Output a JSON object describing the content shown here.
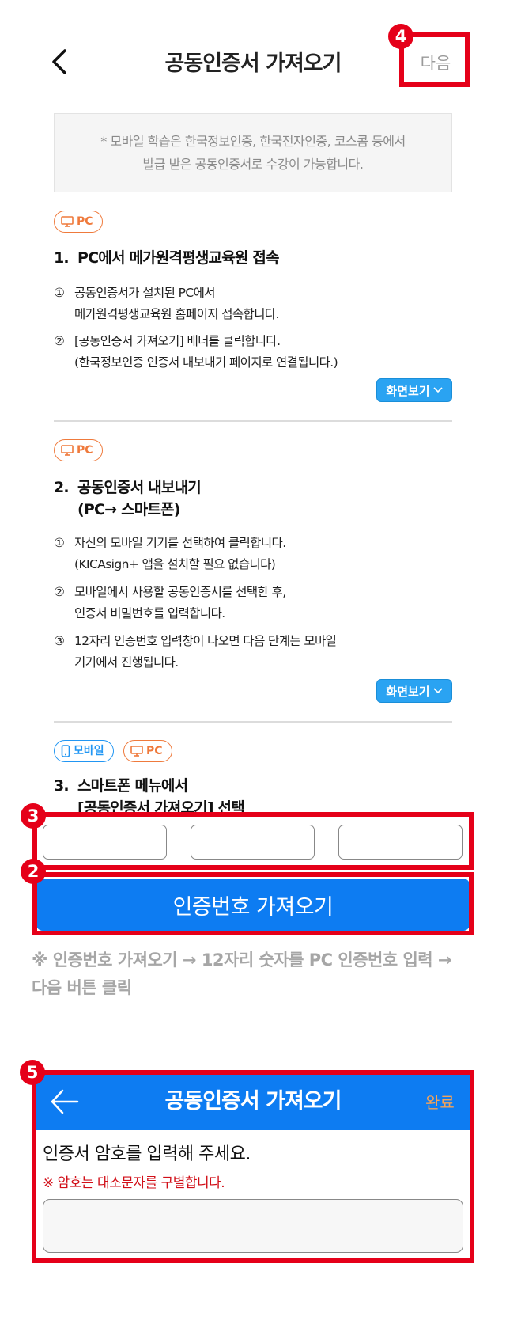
{
  "header": {
    "title": "공동인증서 가져오기",
    "next_label": "다음"
  },
  "notice": {
    "line1": "* 모바일 학습은 한국정보인증, 한국전자인증, 코스콤 등에서",
    "line2": "발급 받은 공동인증서로 수강이 가능합니다."
  },
  "tags": {
    "pc": "PC",
    "mobile": "모바일"
  },
  "steps": [
    {
      "num": "1.",
      "title": [
        "PC에서 메가원격평생교육원 접속"
      ],
      "items": [
        {
          "mark": "①",
          "lines": [
            "공동인증서가 설치된 PC에서",
            "메가원격평생교육원 홈페이지 접속합니다."
          ]
        },
        {
          "mark": "②",
          "lines": [
            "[공동인증서 가져오기] 배너를 클릭합니다.",
            "(한국정보인증 인증서 내보내기 페이지로 연결됩니다.)"
          ]
        }
      ],
      "view_label": "화면보기"
    },
    {
      "num": "2.",
      "title": [
        "공동인증서 내보내기",
        "(PC→ 스마트폰)"
      ],
      "items": [
        {
          "mark": "①",
          "lines": [
            "자신의 모바일 기기를 선택하여 클릭합니다.",
            "(KICAsign+ 앱을 설치할 필요 없습니다)"
          ]
        },
        {
          "mark": "②",
          "lines": [
            "모바일에서 사용할 공동인증서를 선택한 후,",
            "인증서 비밀번호를 입력합니다."
          ]
        },
        {
          "mark": "③",
          "lines": [
            "12자리 인증번호 입력창이 나오면 다음 단계는 모바일",
            "기기에서 진행됩니다."
          ]
        }
      ],
      "view_label": "화면보기"
    },
    {
      "num": "3.",
      "title": [
        "스마트폰 메뉴에서",
        "[공동인증서 가져오기] 선택"
      ]
    }
  ],
  "badges": {
    "b2": "2",
    "b3": "3",
    "b4": "4",
    "b5": "5"
  },
  "fetch_button": "인증번호 가져오기",
  "hint": {
    "line1": "※ 인증번호 가져오기 → 12자리 숫자를 PC 인증번호 입력 →",
    "line2": "다음 버튼 클릭"
  },
  "dialog": {
    "title": "공동인증서 가져오기",
    "done_label": "완료",
    "prompt": "인증서 암호를 입력해 주세요.",
    "warning": "※ 암호는 대소문자를 구별합니다."
  },
  "colors": {
    "primary": "#0d7cf2",
    "highlight": "#e50019",
    "pc_tag": "#ef7a3c",
    "mobile_tag": "#2196f3",
    "view_button": "#2aa3f2"
  }
}
